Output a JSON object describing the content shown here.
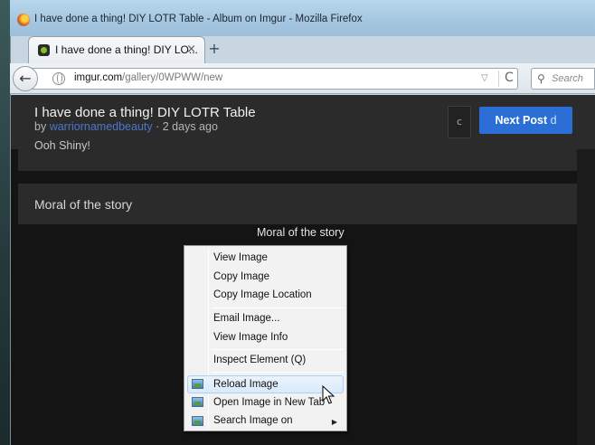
{
  "window": {
    "title": "I have done a thing! DIY LOTR Table - Album on Imgur - Mozilla Firefox"
  },
  "tab": {
    "label": "I have done a thing! DIY LO...",
    "close": "×",
    "new_tab": "+"
  },
  "nav": {
    "back": "←",
    "url_host": "imgur.com",
    "url_path": "/gallery/0WPWW/new",
    "url_dropdown": "▽",
    "reload": "C",
    "search_icon": "🔍",
    "search_placeholder": "Search"
  },
  "post": {
    "title": "I have done a thing! DIY LOTR Table",
    "by_prefix": "by ",
    "author": "warriornamedbeauty",
    "age": " · 2 days ago",
    "prev_description": "Ooh Shiny!",
    "comments_key": "c",
    "next_label": "Next Post ",
    "next_key": "d",
    "caption": "Moral of the story",
    "image_caption": "Moral of the story"
  },
  "context_menu": {
    "items": [
      {
        "label": "View Image"
      },
      {
        "label": "Copy Image"
      },
      {
        "label": "Copy Image Location"
      },
      {
        "label": "Email Image..."
      },
      {
        "label": "View Image Info"
      },
      {
        "label": "Inspect Element (Q)"
      },
      {
        "label": "Reload Image"
      },
      {
        "label": "Open Image in New Tab"
      },
      {
        "label": "Search Image on"
      }
    ],
    "submenu_arrow": "▶"
  },
  "colors": {
    "accent_button": "#2b6fd6",
    "author_link": "#4e76c9",
    "page_bg": "#141414"
  },
  "icons": {
    "firefox": "firefox-logo-icon",
    "imgur": "imgur-favicon-icon",
    "globe": "site-identity-globe-icon",
    "image": "image-icon",
    "cursor": "mouse-pointer-icon"
  }
}
